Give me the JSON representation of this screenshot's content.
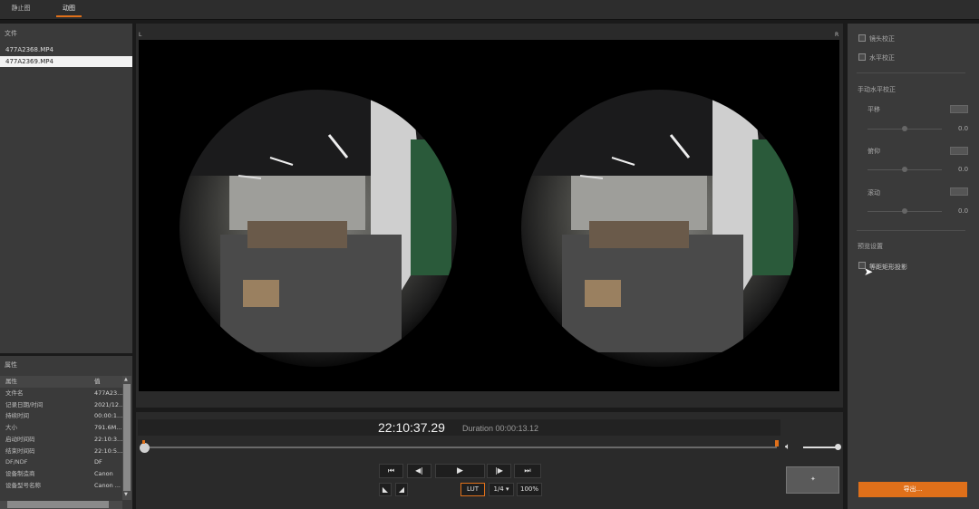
{
  "tabs": [
    {
      "label": "静止图"
    },
    {
      "label": "动图"
    }
  ],
  "files": {
    "header": "文件",
    "items": [
      {
        "name": "477A2368.MP4"
      },
      {
        "name": "477A2369.MP4"
      }
    ]
  },
  "properties": {
    "header": "属性",
    "col_key": "属性",
    "col_val": "值",
    "rows": [
      {
        "k": "文件名",
        "v": "477A23..."
      },
      {
        "k": "记录日期/时间",
        "v": "2021/12..."
      },
      {
        "k": "持续时间",
        "v": "00:00:1..."
      },
      {
        "k": "大小",
        "v": "791.6M..."
      },
      {
        "k": "启动时间码",
        "v": "22:10:3..."
      },
      {
        "k": "结束时间码",
        "v": "22:10:5..."
      },
      {
        "k": "DF/NDF",
        "v": "DF"
      },
      {
        "k": "设备制造商",
        "v": "Canon"
      },
      {
        "k": "设备型号名称",
        "v": "Canon ..."
      }
    ]
  },
  "viewer": {
    "left_label": "L",
    "right_label": "R"
  },
  "playback": {
    "timecode": "22:10:37.29",
    "duration": "Duration 00:00:13.12",
    "lut": "LUT",
    "ratio": "1/4 ▾",
    "zoom": "100%"
  },
  "right": {
    "lens_correction": "镜头校正",
    "level_correction": "水平校正",
    "manual_level": "手动水平校正",
    "sliders": [
      {
        "label": "平移",
        "value": "0.0"
      },
      {
        "label": "俯仰",
        "value": "0.0"
      },
      {
        "label": "滚动",
        "value": "0.0"
      }
    ],
    "preview_settings": "预览设置",
    "equirect": "等距矩形投影",
    "export": "导出..."
  },
  "colors": {
    "accent": "#e0701a"
  }
}
